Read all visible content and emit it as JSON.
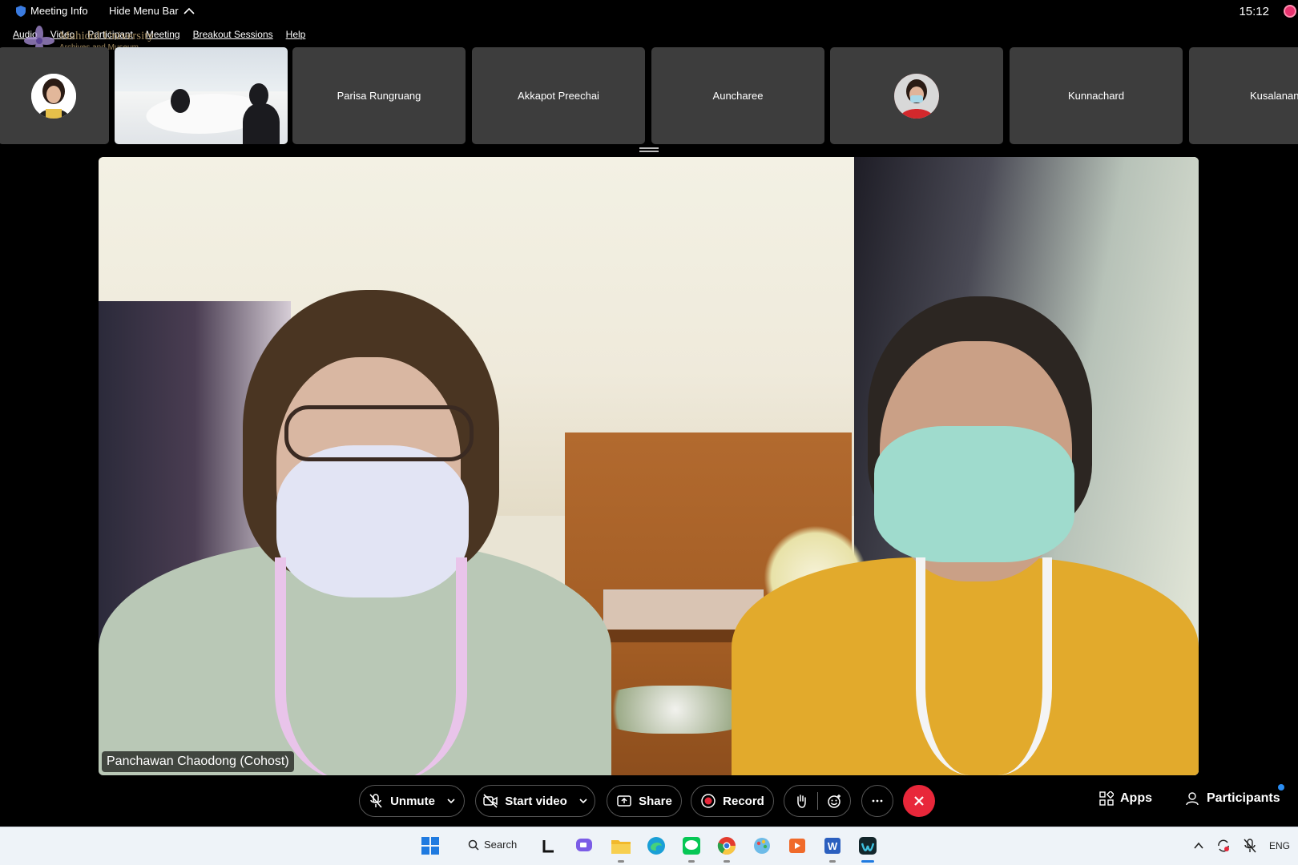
{
  "topbar": {
    "meeting_info": "Meeting Info",
    "hide_menu_bar": "Hide Menu Bar",
    "clock": "15:12"
  },
  "menubar": [
    "Audio",
    "Video",
    "Participant",
    "Meeting",
    "Breakout Sessions",
    "Help"
  ],
  "watermark": {
    "title": "Mahidol University",
    "subtitle": "Archives and Museum"
  },
  "participants": [
    {
      "name": "Parisa Rungruang"
    },
    {
      "name": "Akkapot Preechai"
    },
    {
      "name": "Auncharee"
    },
    {
      "name": "Kunnachard"
    },
    {
      "name": "Kusalanan"
    }
  ],
  "main_video": {
    "speaker_label": "Panchawan Chaodong (Cohost)"
  },
  "toolbar": {
    "unmute": "Unmute",
    "start_video": "Start video",
    "share": "Share",
    "record": "Record",
    "apps": "Apps",
    "participants": "Participants"
  },
  "taskbar": {
    "search": "Search",
    "language": "ENG"
  },
  "colors": {
    "end_call": "#e8273a",
    "record_dot": "#e8273a",
    "tile_bg": "#3d3d3d",
    "taskbar_bg": "#eef3f8",
    "notify_dot": "#2a8df3"
  }
}
